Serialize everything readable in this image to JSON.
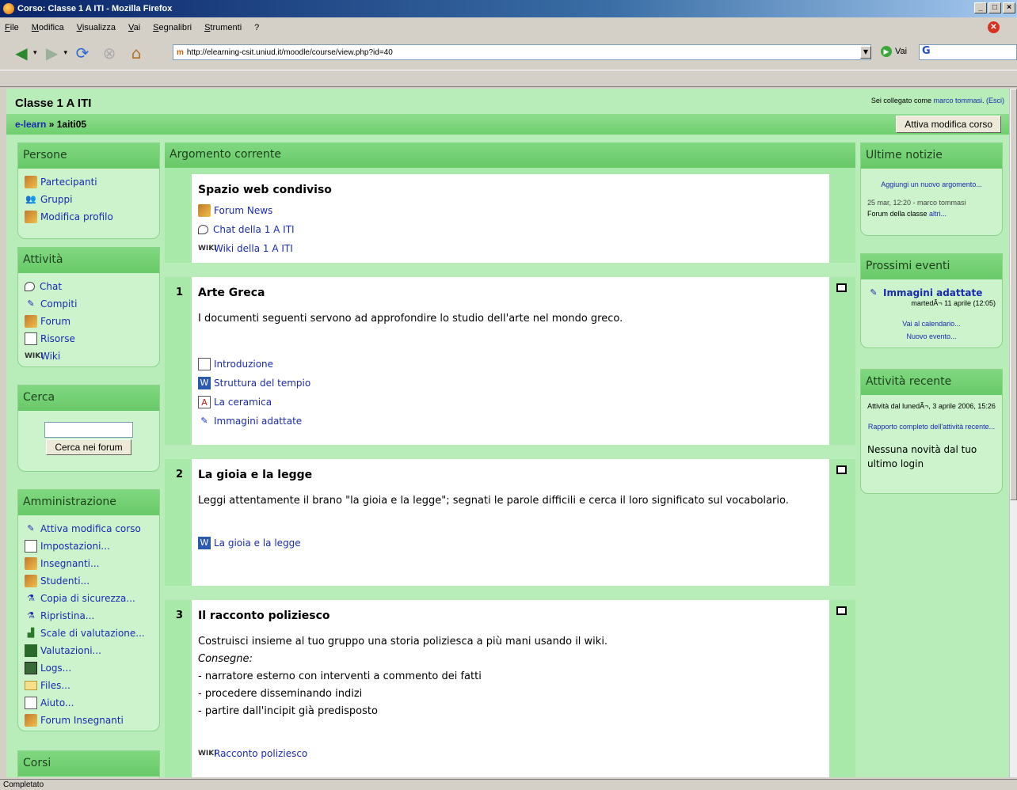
{
  "window": {
    "title": "Corso: Classe 1 A ITI - Mozilla Firefox"
  },
  "menu": [
    "File",
    "Modifica",
    "Visualizza",
    "Vai",
    "Segnalibri",
    "Strumenti",
    "?"
  ],
  "nav": {
    "url": "http://elearning-csit.uniud.it/moodle/course/view.php?id=40",
    "go_label": "Vai",
    "search_value": "G"
  },
  "header": {
    "course_title": "Classe 1 A ITI",
    "login_prefix": "Sei collegato come",
    "login_user": "marco tommasi",
    "logout": "(Esci)",
    "breadcrumb_home": "e-learn",
    "breadcrumb_sep": "»",
    "breadcrumb_current": "1aiti05",
    "edit_button": "Attiva modifica corso"
  },
  "left": {
    "persone": {
      "title": "Persone",
      "items": [
        "Partecipanti",
        "Gruppi",
        "Modifica profilo"
      ]
    },
    "attivita": {
      "title": "Attività",
      "items": [
        "Chat",
        "Compiti",
        "Forum",
        "Risorse",
        "Wiki"
      ]
    },
    "cerca": {
      "title": "Cerca",
      "button": "Cerca nei forum",
      "value": ""
    },
    "admin": {
      "title": "Amministrazione",
      "items": [
        "Attiva modifica corso",
        "Impostazioni...",
        "Insegnanti...",
        "Studenti...",
        "Copia di sicurezza...",
        "Ripristina...",
        "Scale di valutazione...",
        "Valutazioni...",
        "Logs...",
        "Files...",
        "Aiuto...",
        "Forum Insegnanti"
      ]
    },
    "corsi": {
      "title": "Corsi"
    }
  },
  "center": {
    "header": "Argomento corrente",
    "section0": {
      "title": "Spazio web condiviso",
      "links": [
        "Forum News",
        "Chat della 1 A ITI",
        "Wiki della 1 A ITI"
      ]
    },
    "section1": {
      "num": "1",
      "title": "Arte Greca",
      "text": "I documenti seguenti servono ad approfondire lo studio dell'arte nel mondo greco.",
      "links": [
        "Introduzione",
        "Struttura del tempio",
        "La ceramica",
        "Immagini adattate"
      ]
    },
    "section2": {
      "num": "2",
      "title": "La gioia e la legge",
      "text": "Leggi attentamente il brano \"la gioia e la legge\"; segnati le parole difficili e cerca il loro significato sul vocabolario.",
      "links": [
        "La gioia e la legge"
      ]
    },
    "section3": {
      "num": "3",
      "title": "Il racconto poliziesco",
      "lines": [
        "Costruisci insieme al tuo gruppo una storia poliziesca a più mani usando il wiki.",
        "Consegne:",
        "- narratore esterno con interventi a commento dei fatti",
        "- procedere disseminando indizi",
        "- partire dall'incipit già predisposto"
      ],
      "links": [
        "Racconto poliziesco"
      ]
    }
  },
  "right": {
    "news": {
      "title": "Ultime notizie",
      "add": "Aggiungi un nuovo argomento...",
      "meta": "25 mar, 12:20 - marco tommasi",
      "forum": "Forum della classe",
      "more": "altri..."
    },
    "events": {
      "title": "Prossimi eventi",
      "event": "Immagini adattate",
      "date": "martedÃ¬ 11 aprile (12:05)",
      "calendar": "Vai al calendario...",
      "new": "Nuovo evento..."
    },
    "recent": {
      "title": "Attività recente",
      "since": "Attività dal lunedÃ¬, 3 aprile 2006, 15:26",
      "report": "Rapporto completo dell'attività recente...",
      "none": "Nessuna novità dal tuo ultimo login"
    }
  },
  "status": "Completato"
}
